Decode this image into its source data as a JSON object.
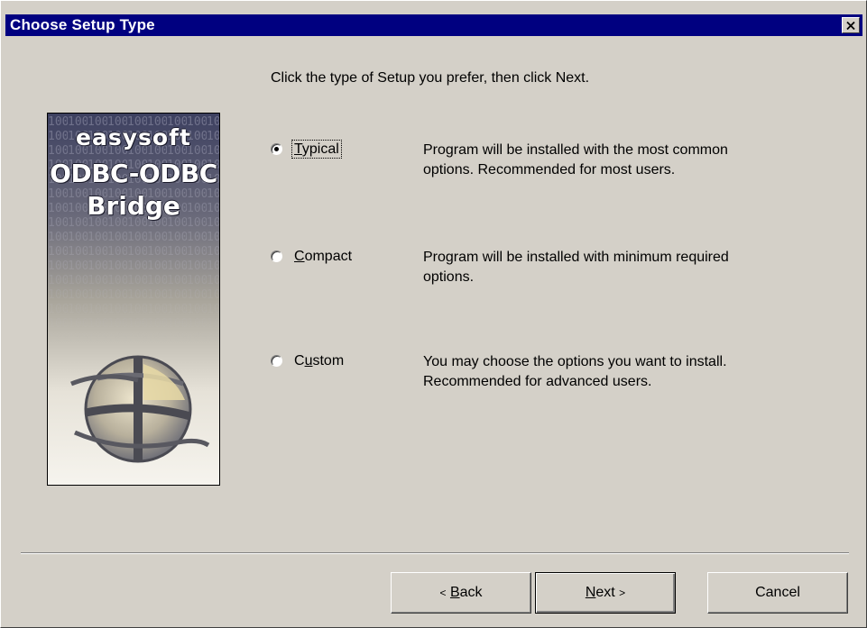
{
  "window": {
    "title": "Choose Setup Type",
    "close_icon": "close-icon"
  },
  "instruction": "Click the type of Setup you prefer, then click Next.",
  "brand": {
    "line1": "easysoft",
    "line2": "ODBC-ODBC",
    "line3": "Bridge"
  },
  "options": [
    {
      "pre": "",
      "accel": "T",
      "post": "ypical",
      "selected": true,
      "desc1": "Program will be installed with the most common",
      "desc2": "options.  Recommended for most users."
    },
    {
      "pre": "",
      "accel": "C",
      "post": "ompact",
      "selected": false,
      "desc1": "Program will be installed with minimum required",
      "desc2": "options."
    },
    {
      "pre": "C",
      "accel": "u",
      "post": "stom",
      "selected": false,
      "desc1": "You may choose the options you want to install.",
      "desc2": "Recommended for advanced users."
    }
  ],
  "buttons": {
    "back_arrow": "<",
    "back_accel": "B",
    "back_rest": "ack",
    "next_accel": "N",
    "next_rest": "ext",
    "next_arrow": ">",
    "cancel": "Cancel"
  },
  "colors": {
    "titlebar": "#000080",
    "dialog_bg": "#d4d0c8",
    "title_text": "#ffffff"
  }
}
